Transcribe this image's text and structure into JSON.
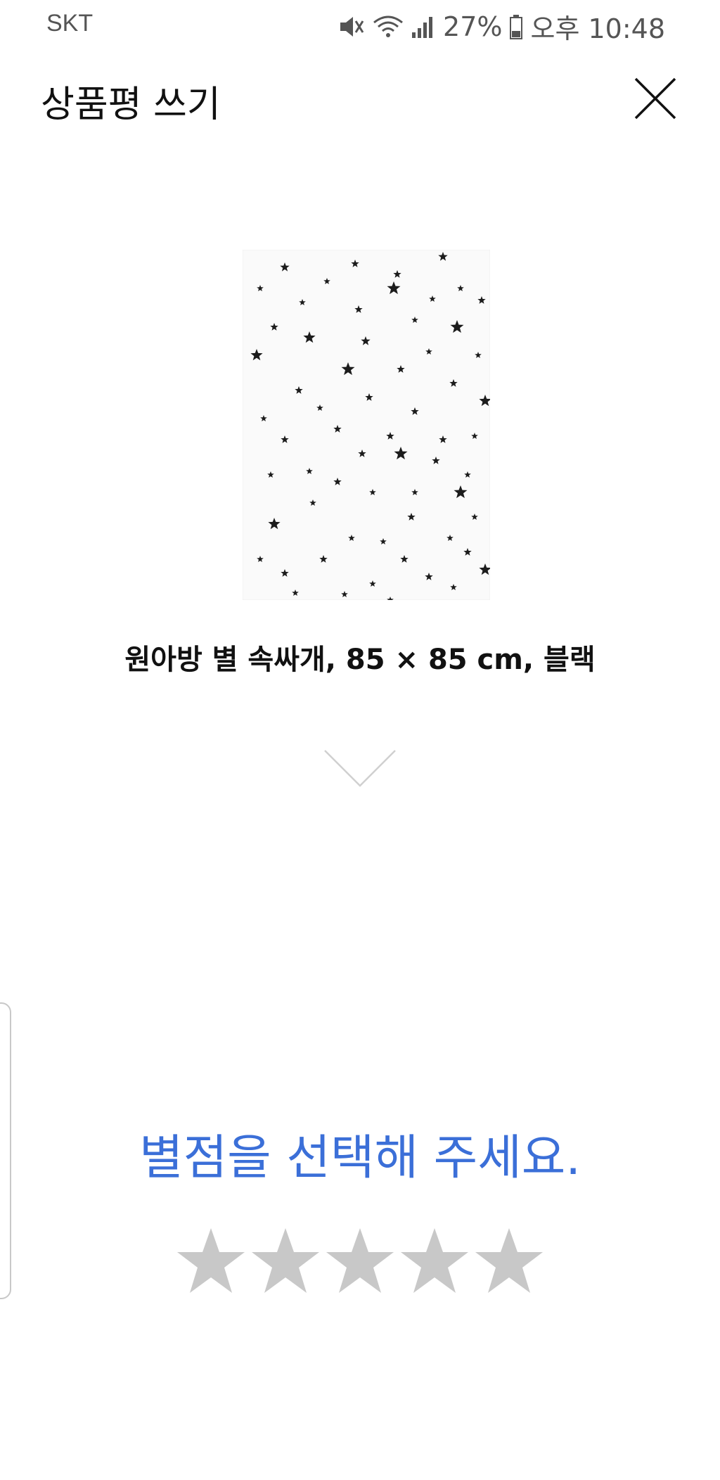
{
  "status_bar": {
    "carrier": "SKT",
    "battery_percent": "27%",
    "time": "오후 10:48",
    "icons": [
      "mute-icon",
      "wifi-icon",
      "signal-icon",
      "battery-icon"
    ]
  },
  "header": {
    "title": "상품평 쓰기",
    "close_icon": "close-icon"
  },
  "product": {
    "image_desc_icon": "star-pattern-swaddle-image",
    "name": "원아방 별 속싸개, 85 × 85 cm, 블랙"
  },
  "expand_icon": "chevron-down-icon",
  "rating": {
    "prompt": "별점을 선택해 주세요.",
    "max_stars": 5,
    "selected": 0,
    "star_color": "#c8c8c8"
  },
  "colors": {
    "accent": "#3b6fd8",
    "text": "#111111",
    "status": "#555555"
  }
}
